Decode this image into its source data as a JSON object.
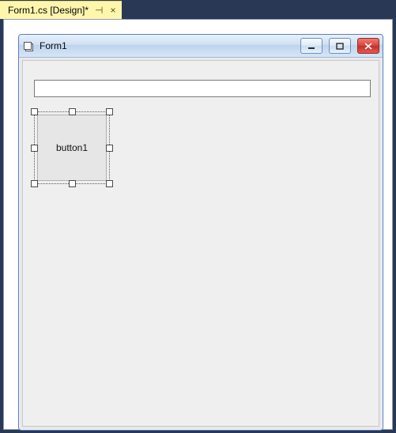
{
  "tab": {
    "label": "Form1.cs [Design]*",
    "pin_glyph": "⊣",
    "close_glyph": "×"
  },
  "form": {
    "title": "Form1",
    "controls": {
      "textbox1_value": "",
      "button1_label": "button1"
    }
  }
}
